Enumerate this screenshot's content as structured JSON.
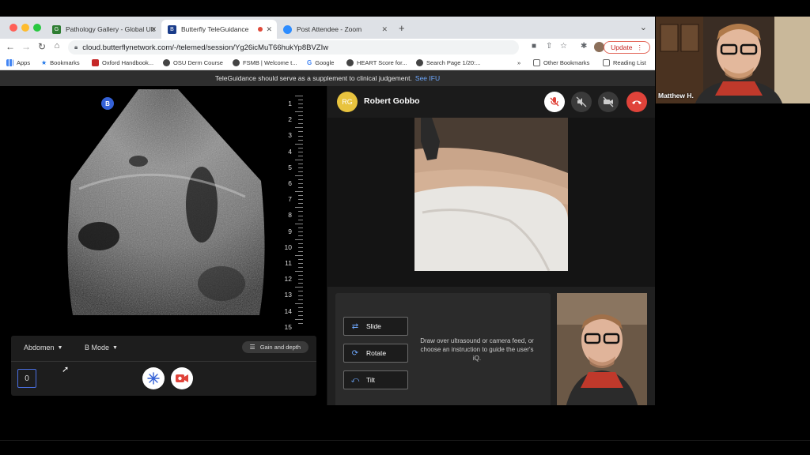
{
  "browser": {
    "tabs": [
      {
        "title": "Pathology Gallery - Global Ultr",
        "favicon_color": "#2e7d32"
      },
      {
        "title": "Butterfly TeleGuidance",
        "favicon_color": "#1a3c8a"
      },
      {
        "title": "Post Attendee - Zoom",
        "favicon_color": "#2d8cff"
      }
    ],
    "new_tab": "+",
    "tab_menu": "⌄",
    "url": "cloud.butterflynetwork.com/-/telemed/session/Yg26icMuT66hukYp8BVZIw",
    "update_label": "Update",
    "bookmarks": [
      {
        "label": "Apps",
        "icon": "apps-icon"
      },
      {
        "label": "Bookmarks",
        "icon": "star-icon"
      },
      {
        "label": "Oxford Handbook...",
        "icon": "book-icon"
      },
      {
        "label": "OSU Derm Course",
        "icon": "globe-icon"
      },
      {
        "label": "FSMB | Welcome t...",
        "icon": "globe-icon"
      },
      {
        "label": "Google",
        "icon": "google-icon"
      },
      {
        "label": "HEART Score for...",
        "icon": "globe-icon"
      },
      {
        "label": "Search Page 1/20:...",
        "icon": "globe-icon"
      }
    ],
    "bookmarks_more": "»",
    "other_bookmarks": "Other Bookmarks",
    "reading_list": "Reading List"
  },
  "notice": {
    "text": "TeleGuidance should serve as a supplement to clinical judgement.",
    "link": "See IFU"
  },
  "ultrasound": {
    "badge": "B",
    "depth_marks": [
      "1",
      "2",
      "3",
      "4",
      "5",
      "6",
      "7",
      "8",
      "9",
      "10",
      "11",
      "12",
      "13",
      "14",
      "15"
    ],
    "preset": "Abdomen",
    "mode": "B Mode",
    "gain_label": "Gain and depth",
    "zero_value": "0"
  },
  "caller": {
    "initials": "RG",
    "name": "Robert Gobbo",
    "avatar_color": "#e8c33e"
  },
  "guidance": {
    "buttons": [
      {
        "label": "Slide",
        "icon": "slide-icon"
      },
      {
        "label": "Rotate",
        "icon": "rotate-icon"
      },
      {
        "label": "Tilt",
        "icon": "tilt-icon"
      }
    ],
    "instruction": "Draw over ultrasound or camera feed, or choose an instruction to guide the user's iQ."
  },
  "participant": {
    "name": "Matthew H."
  },
  "colors": {
    "accent_blue": "#3461d6",
    "end_call_red": "#e0433a",
    "caller_yellow": "#e8c33e"
  }
}
